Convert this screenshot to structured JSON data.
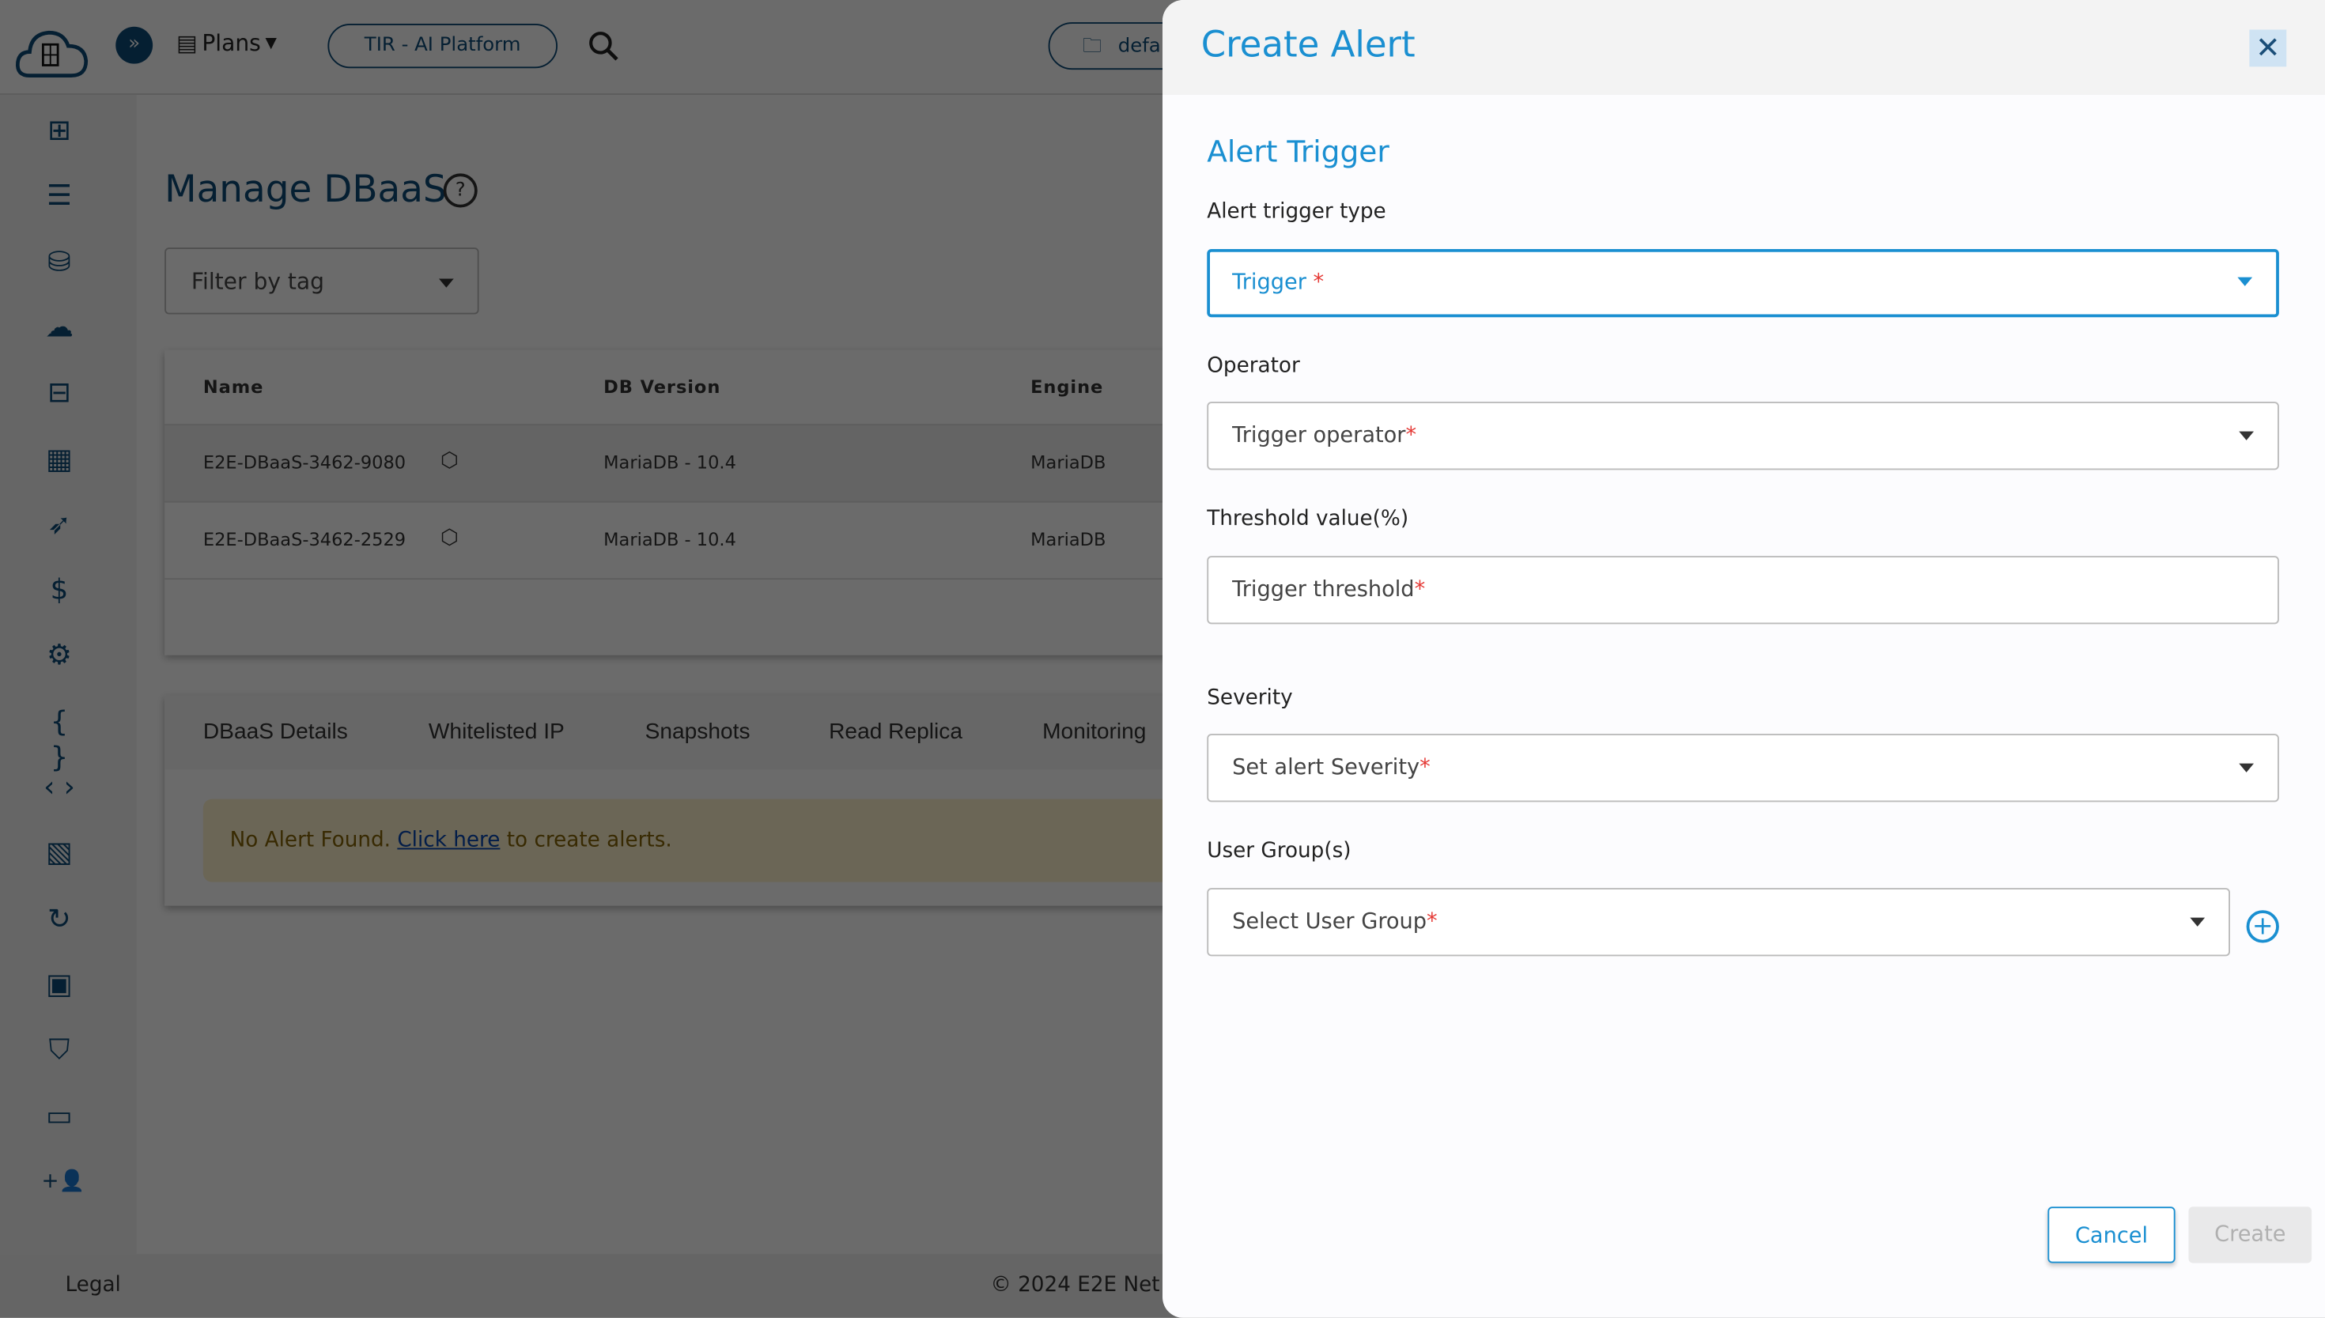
{
  "topbar": {
    "plans_label": "Plans",
    "tir_label": "TIR - AI Platform",
    "project_label": "defa",
    "logo_text": "E2E Cloud"
  },
  "sidebar": {
    "icons": [
      "dashboard-icon",
      "nodes-icon",
      "database-icon",
      "cloud-upload-icon",
      "network-icon",
      "grid-icon",
      "rocket-icon",
      "billing-icon",
      "settings-icon",
      "braces-icon",
      "code-icon",
      "document-icon",
      "refresh-icon",
      "image-icon",
      "security-icon",
      "monitor-icon",
      "add-user-icon"
    ]
  },
  "main": {
    "title": "Manage DBaaS",
    "filter_placeholder": "Filter by tag",
    "table": {
      "headers": [
        "Name",
        "DB Version",
        "Engine"
      ],
      "rows": [
        [
          "E2E-DBaaS-3462-9080",
          "MariaDB - 10.4",
          "MariaDB"
        ],
        [
          "E2E-DBaaS-3462-2529",
          "MariaDB - 10.4",
          "MariaDB"
        ]
      ]
    },
    "tabs": [
      "DBaaS Details",
      "Whitelisted IP",
      "Snapshots",
      "Read Replica",
      "Monitoring"
    ],
    "alert": {
      "prefix": "No Alert Found. ",
      "link": "Click here",
      "suffix": " to create alerts."
    }
  },
  "footer": {
    "legal": "Legal",
    "copyright": "© 2024 E2E Net"
  },
  "panel": {
    "title": "Create Alert",
    "section": "Alert Trigger",
    "fields": [
      {
        "label": "Alert trigger type",
        "placeholder": "Trigger",
        "required": "*"
      },
      {
        "label": "Operator",
        "placeholder": "Trigger operator",
        "required": "*"
      },
      {
        "label": "Threshold value(%)",
        "placeholder": "Trigger threshold",
        "required": "*"
      },
      {
        "label": "Severity",
        "placeholder": "Set alert Severity",
        "required": "*"
      },
      {
        "label": "User Group(s)",
        "placeholder": "Select User Group",
        "required": "*"
      }
    ],
    "cancel": "Cancel",
    "create": "Create"
  },
  "colors": {
    "accent": "#1a8fd1",
    "brand": "#0c4a77",
    "required": "#e53935"
  }
}
